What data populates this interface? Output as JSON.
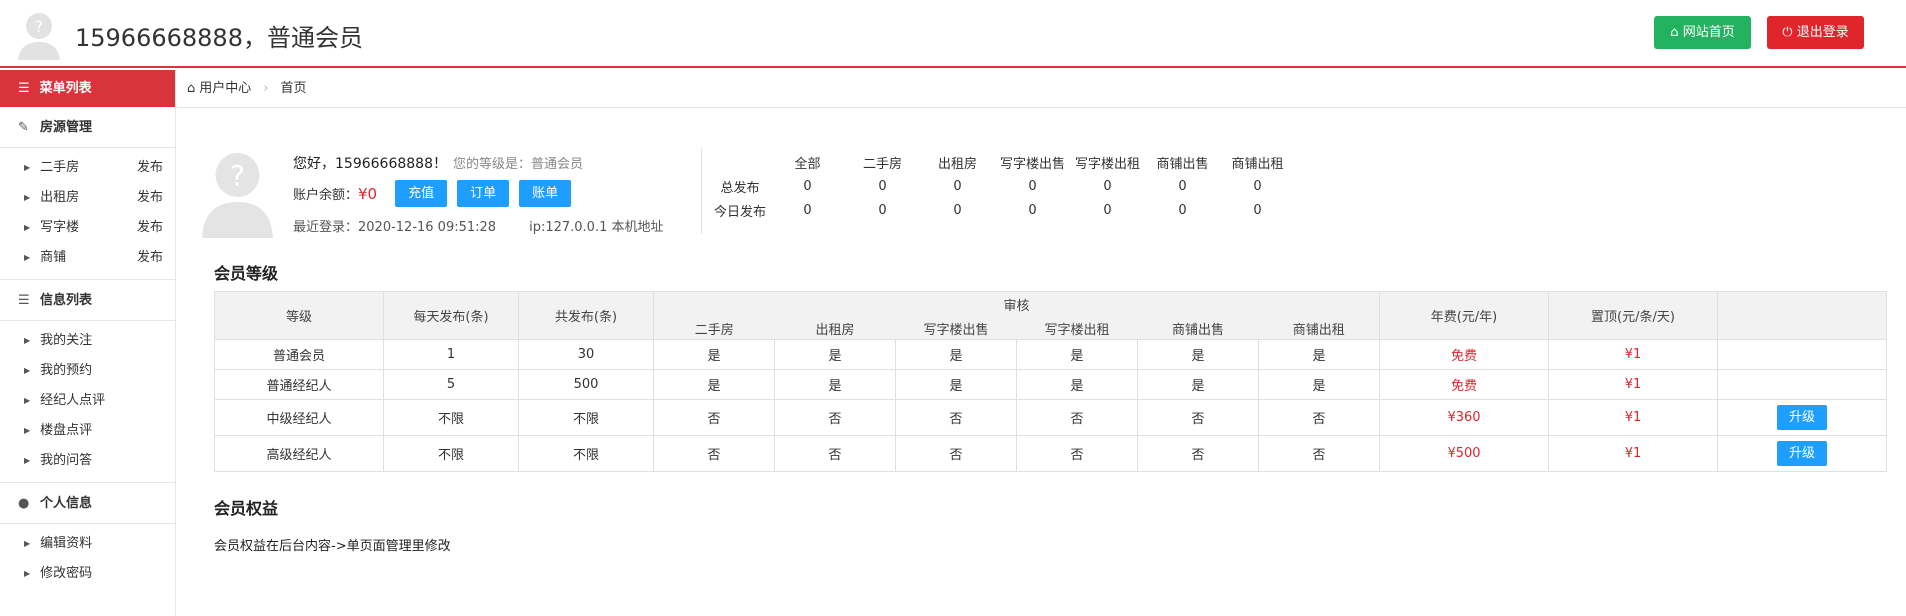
{
  "header": {
    "title": "15966668888，普通会员",
    "home_label": "网站首页",
    "logout_label": "退出登录"
  },
  "sidebar": {
    "menu_head": "菜单列表",
    "groups": [
      {
        "title": "房源管理",
        "icon": "edit-icon",
        "items": [
          {
            "label": "二手房",
            "action": "发布"
          },
          {
            "label": "出租房",
            "action": "发布"
          },
          {
            "label": "写字楼",
            "action": "发布"
          },
          {
            "label": "商铺",
            "action": "发布"
          }
        ]
      },
      {
        "title": "信息列表",
        "icon": "list-icon",
        "items": [
          {
            "label": "我的关注"
          },
          {
            "label": "我的预约"
          },
          {
            "label": "经纪人点评"
          },
          {
            "label": "楼盘点评"
          },
          {
            "label": "我的问答"
          }
        ]
      },
      {
        "title": "个人信息",
        "icon": "user-icon",
        "items": [
          {
            "label": "编辑资料"
          },
          {
            "label": "修改密码"
          }
        ]
      }
    ]
  },
  "breadcrumb": {
    "root": "用户中心",
    "current": "首页"
  },
  "profile": {
    "greeting": "您好，15966668888！",
    "level_text": "您的等级是：普通会员",
    "balance_label": "账户余额：",
    "balance": "¥0",
    "recharge": "充值",
    "orders": "订单",
    "bills": "账单",
    "last_login": "最近登录：2020-12-16 09:51:28",
    "ip": "ip:127.0.0.1 本机地址"
  },
  "stats": {
    "headers": [
      "全部",
      "二手房",
      "出租房",
      "写字楼出售",
      "写字楼出租",
      "商铺出售",
      "商铺出租"
    ],
    "rows": [
      {
        "label": "总发布",
        "values": [
          "0",
          "0",
          "0",
          "0",
          "0",
          "0",
          "0"
        ]
      },
      {
        "label": "今日发布",
        "values": [
          "0",
          "0",
          "0",
          "0",
          "0",
          "0",
          "0"
        ]
      }
    ]
  },
  "levels": {
    "section_title": "会员等级",
    "headers": {
      "level": "等级",
      "daily": "每天发布(条)",
      "total": "共发布(条)",
      "audit": "审核",
      "audit_cols": [
        "二手房",
        "出租房",
        "写字楼出售",
        "写字楼出租",
        "商铺出售",
        "商铺出租"
      ],
      "fee": "年费(元/年)",
      "top": "置顶(元/条/天)"
    },
    "rows": [
      {
        "name": "普通会员",
        "daily": "1",
        "total": "30",
        "audit": [
          "是",
          "是",
          "是",
          "是",
          "是",
          "是"
        ],
        "fee": "免费",
        "top": "¥1",
        "upgrade": ""
      },
      {
        "name": "普通经纪人",
        "daily": "5",
        "total": "500",
        "audit": [
          "是",
          "是",
          "是",
          "是",
          "是",
          "是"
        ],
        "fee": "免费",
        "top": "¥1",
        "upgrade": ""
      },
      {
        "name": "中级经纪人",
        "daily": "不限",
        "total": "不限",
        "audit": [
          "否",
          "否",
          "否",
          "否",
          "否",
          "否"
        ],
        "fee": "¥360",
        "top": "¥1",
        "upgrade": "升级"
      },
      {
        "name": "高级经纪人",
        "daily": "不限",
        "total": "不限",
        "audit": [
          "否",
          "否",
          "否",
          "否",
          "否",
          "否"
        ],
        "fee": "¥500",
        "top": "¥1",
        "upgrade": "升级"
      }
    ]
  },
  "rights": {
    "section_title": "会员权益",
    "text": "会员权益在后台内容->单页面管理里修改"
  },
  "colors": {
    "brand_red": "#d9343b",
    "btn_blue": "#1e9fff",
    "home_green": "#23b25f",
    "logout_red": "#e0252b"
  }
}
